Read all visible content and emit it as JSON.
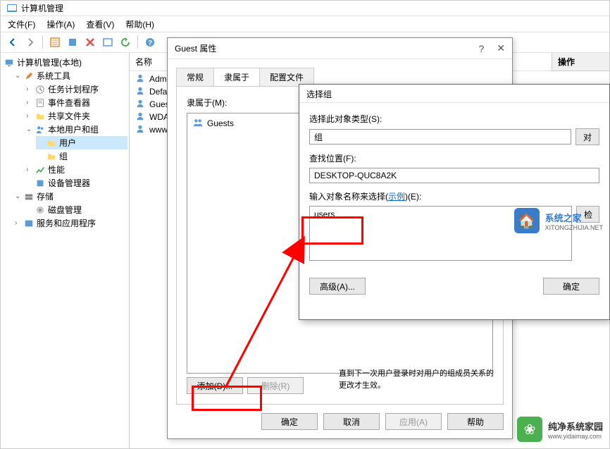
{
  "mainWindow": {
    "title": "计算机管理"
  },
  "menuBar": {
    "file": "文件(F)",
    "action": "操作(A)",
    "view": "查看(V)",
    "help": "帮助(H)"
  },
  "tree": {
    "root": "计算机管理(本地)",
    "systemTools": "系统工具",
    "taskScheduler": "任务计划程序",
    "eventViewer": "事件查看器",
    "sharedFolders": "共享文件夹",
    "localUsersGroups": "本地用户和组",
    "users": "用户",
    "groups": "组",
    "performance": "性能",
    "deviceManager": "设备管理器",
    "storage": "存储",
    "diskManagement": "磁盘管理",
    "servicesApps": "服务和应用程序"
  },
  "listPanel": {
    "header": "名称",
    "items": [
      "Admi",
      "Defa",
      "Gues",
      "WDA",
      "www."
    ]
  },
  "actionsPanel": {
    "header": "操作"
  },
  "propsDialog": {
    "title": "Guest 属性",
    "tabs": {
      "general": "常规",
      "memberOf": "隶属于",
      "profile": "配置文件"
    },
    "memberLabel": "隶属于(M):",
    "memberItem": "Guests",
    "addBtn": "添加(D)...",
    "removeBtn": "删除(R)",
    "note": "直到下一次用户登录时对用户的组成员关系的更改才生效。",
    "okBtn": "确定",
    "cancelBtn": "取消",
    "applyBtn": "应用(A)",
    "helpBtn": "帮助"
  },
  "selectDialog": {
    "title": "选择组",
    "objectTypeLabel": "选择此对象类型(S):",
    "objectTypeValue": "组",
    "objectTypeBtn": "对",
    "locationLabel": "查找位置(F):",
    "locationValue": "DESKTOP-QUC8A2K",
    "namesLabel1": "输入对象名称来选择(",
    "namesLink": "示例",
    "namesLabel2": ")(E):",
    "namesValue": "users",
    "checkBtn": "检",
    "advancedBtn": "高级(A)...",
    "okBtn": "确定"
  },
  "watermark1": {
    "title": "系统之家",
    "sub": "XITONGZHIJIA.NET"
  },
  "watermark2": {
    "title": "纯净系统家园",
    "sub": "www.yidaimay.com"
  }
}
